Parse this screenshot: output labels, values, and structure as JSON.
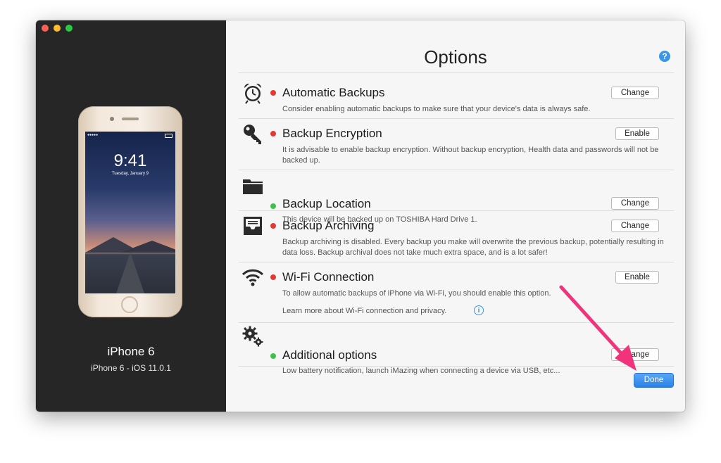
{
  "window": {
    "controls": [
      "close",
      "minimize",
      "zoom"
    ]
  },
  "sidebar": {
    "device_name": "iPhone 6",
    "device_info": "iPhone 6 - iOS 11.0.1",
    "lock_time": "9:41",
    "lock_date": "Tuesday, January 9"
  },
  "main": {
    "title": "Options",
    "help_icon": "?",
    "rows": [
      {
        "icon": "alarm-clock-icon",
        "status": "red",
        "title": "Automatic Backups",
        "description": "Consider enabling automatic backups to make sure that your device's data is always safe.",
        "button": "Change"
      },
      {
        "icon": "key-icon",
        "status": "red",
        "title": "Backup Encryption",
        "description": "It is advisable to enable backup encryption. Without backup encryption, Health data and passwords will not be backed up.",
        "button": "Enable"
      },
      {
        "icon": "folder-icon",
        "status": "green",
        "title": "Backup Location",
        "description": "This device will be backed up on TOSHIBA Hard Drive 1.",
        "button": "Change"
      },
      {
        "icon": "archive-tray-icon",
        "status": "red",
        "title": "Backup Archiving",
        "description": "Backup archiving is disabled. Every backup you make will overwrite the previous backup, potentially resulting in data loss. Backup archival does not take much extra space, and is a lot safer!",
        "button": "Change"
      },
      {
        "icon": "wifi-icon",
        "status": "red",
        "title": "Wi-Fi Connection",
        "description": "To allow automatic backups of iPhone via Wi-Fi, you should enable this option.",
        "link_text": "Learn more about Wi-Fi connection and privacy.",
        "button": "Enable"
      },
      {
        "icon": "gears-icon",
        "status": "green",
        "title": "Additional options",
        "description": "Low battery notification, launch iMazing when connecting a device via USB, etc...",
        "button": "Change"
      }
    ],
    "done_label": "Done"
  },
  "colors": {
    "status_red": "#e23a32",
    "status_green": "#40c24a",
    "accent_blue": "#2a82e6",
    "arrow_pink": "#f0337a"
  }
}
